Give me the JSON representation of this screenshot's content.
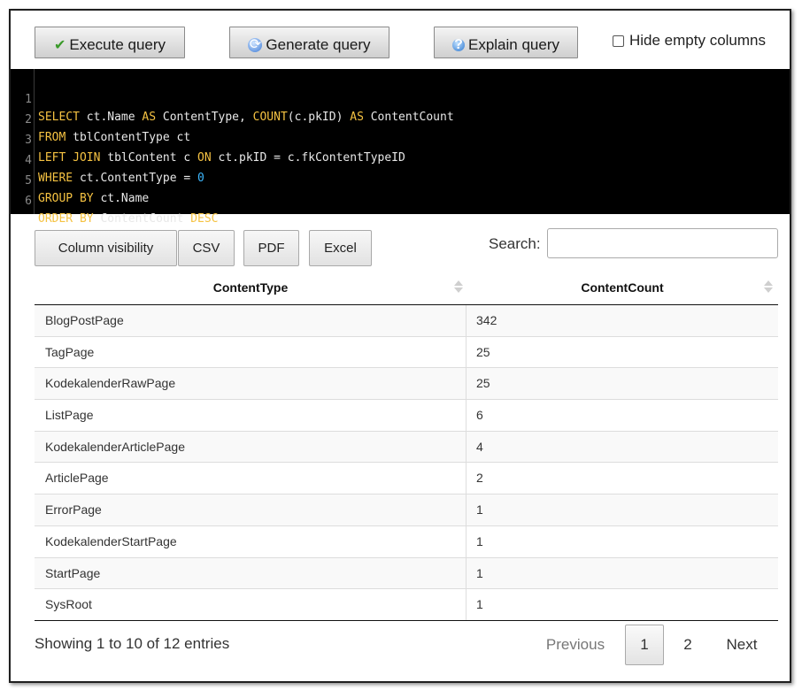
{
  "toolbar": {
    "execute_label": "Execute query",
    "generate_label": "Generate query",
    "explain_label": "Explain query",
    "hide_empty_label": "Hide empty columns",
    "hide_empty_checked": false
  },
  "editor": {
    "lines": [
      {
        "n": "1"
      },
      {
        "n": "2"
      },
      {
        "n": "3"
      },
      {
        "n": "4"
      },
      {
        "n": "5"
      },
      {
        "n": "6"
      }
    ],
    "tokens": {
      "l1": [
        "SELECT",
        " ct.Name ",
        "AS",
        " ContentType, ",
        "COUNT",
        "(c.pkID) ",
        "AS",
        " ContentCount"
      ],
      "l2": [
        "FROM",
        " tblContentType ct"
      ],
      "l3": [
        "LEFT JOIN",
        " tblContent c ",
        "ON",
        " ct.pkID = c.fkContentTypeID"
      ],
      "l4": [
        "WHERE",
        " ct.ContentType = ",
        "0"
      ],
      "l5": [
        "GROUP BY",
        " ct.Name"
      ],
      "l6": [
        "ORDER BY",
        " ContentCount ",
        "DESC"
      ]
    },
    "colors": {
      "keyword": "#f5c242",
      "number": "#3db8ff",
      "text": "#e8e8e8",
      "background": "#000000"
    }
  },
  "datatable": {
    "buttons": {
      "column_visibility": "Column visibility",
      "csv": "CSV",
      "pdf": "PDF",
      "excel": "Excel"
    },
    "search_label": "Search:",
    "search_value": "",
    "columns": [
      "ContentType",
      "ContentCount"
    ],
    "rows": [
      [
        "BlogPostPage",
        "342"
      ],
      [
        "TagPage",
        "25"
      ],
      [
        "KodekalenderRawPage",
        "25"
      ],
      [
        "ListPage",
        "6"
      ],
      [
        "KodekalenderArticlePage",
        "4"
      ],
      [
        "ArticlePage",
        "2"
      ],
      [
        "ErrorPage",
        "1"
      ],
      [
        "KodekalenderStartPage",
        "1"
      ],
      [
        "StartPage",
        "1"
      ],
      [
        "SysRoot",
        "1"
      ]
    ],
    "info": "Showing 1 to 10 of 12 entries",
    "pagination": {
      "previous": "Previous",
      "pages": [
        "1",
        "2"
      ],
      "current": "1",
      "next": "Next"
    }
  }
}
